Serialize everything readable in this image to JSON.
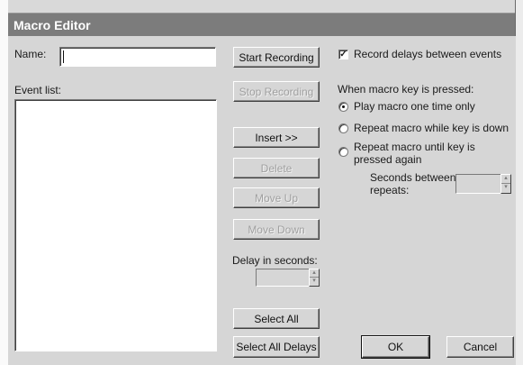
{
  "window": {
    "title": "Macro Editor"
  },
  "name_field": {
    "label": "Name:",
    "value": ""
  },
  "event_list": {
    "label": "Event list:"
  },
  "buttons": {
    "start_recording": "Start Recording",
    "stop_recording": "Stop Recording",
    "insert": "Insert >>",
    "delete": "Delete",
    "move_up": "Move Up",
    "move_down": "Move Down",
    "select_all": "Select All",
    "select_all_delays": "Select All Delays",
    "ok": "OK",
    "cancel": "Cancel"
  },
  "delay": {
    "label": "Delay in seconds:",
    "value": ""
  },
  "record_delays": {
    "label": "Record delays between events",
    "checked": true,
    "mark": "✓"
  },
  "macro_key": {
    "heading": "When macro key is pressed:",
    "options": [
      {
        "label": "Play macro one time only",
        "selected": true
      },
      {
        "label": "Repeat macro while key is down",
        "selected": false
      },
      {
        "label_line1": "Repeat macro until key is",
        "label_line2": "pressed again",
        "selected": false
      }
    ],
    "seconds_between": {
      "line1": "Seconds between",
      "line2": "repeats:",
      "value": ""
    }
  },
  "spinner_glyphs": {
    "up": "▴",
    "down": "▾"
  }
}
